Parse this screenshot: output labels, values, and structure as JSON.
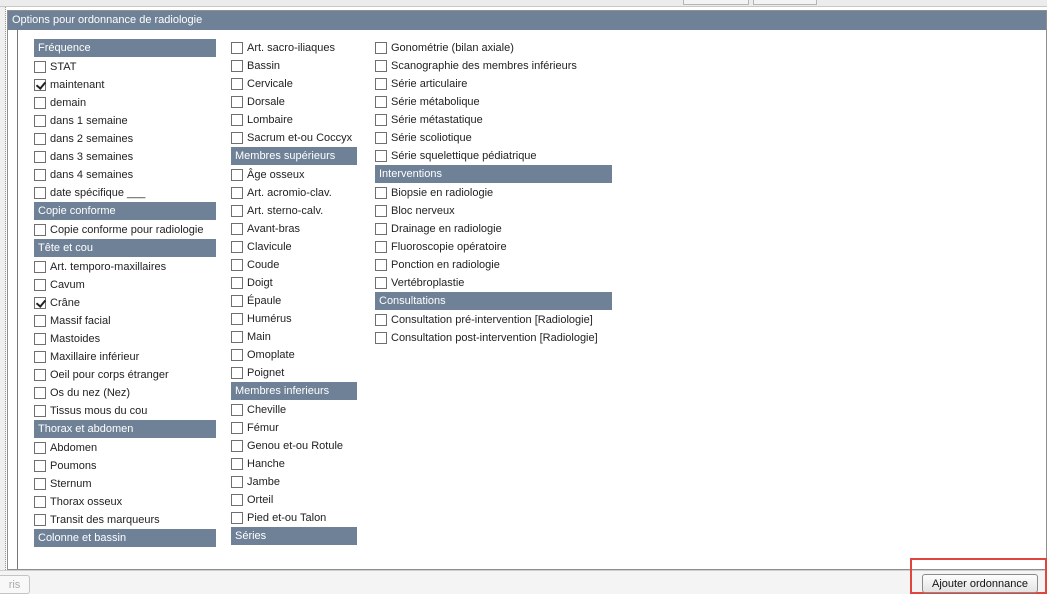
{
  "panel": {
    "title": "Options pour ordonnance de radiologie"
  },
  "columns": [
    [
      {
        "type": "section",
        "label": "Fréquence"
      },
      {
        "type": "option",
        "label": "STAT",
        "checked": false
      },
      {
        "type": "option",
        "label": "maintenant",
        "checked": true
      },
      {
        "type": "option",
        "label": "demain",
        "checked": false
      },
      {
        "type": "option",
        "label": "dans 1 semaine",
        "checked": false
      },
      {
        "type": "option",
        "label": "dans 2 semaines",
        "checked": false
      },
      {
        "type": "option",
        "label": "dans 3 semaines",
        "checked": false
      },
      {
        "type": "option",
        "label": "dans 4 semaines",
        "checked": false
      },
      {
        "type": "option",
        "label": "date spécifique ___",
        "checked": false
      },
      {
        "type": "section",
        "label": "Copie conforme"
      },
      {
        "type": "option",
        "label": "Copie conforme pour radiologie",
        "checked": false
      },
      {
        "type": "section",
        "label": "Tête et cou"
      },
      {
        "type": "option",
        "label": "Art. temporo-maxillaires",
        "checked": false
      },
      {
        "type": "option",
        "label": "Cavum",
        "checked": false
      },
      {
        "type": "option",
        "label": "Crâne",
        "checked": true
      },
      {
        "type": "option",
        "label": "Massif facial",
        "checked": false
      },
      {
        "type": "option",
        "label": "Mastoides",
        "checked": false
      },
      {
        "type": "option",
        "label": "Maxillaire inférieur",
        "checked": false
      },
      {
        "type": "option",
        "label": "Oeil pour corps étranger",
        "checked": false
      },
      {
        "type": "option",
        "label": "Os du nez (Nez)",
        "checked": false
      },
      {
        "type": "option",
        "label": "Tissus mous du cou",
        "checked": false
      },
      {
        "type": "section",
        "label": "Thorax et abdomen"
      },
      {
        "type": "option",
        "label": "Abdomen",
        "checked": false
      },
      {
        "type": "option",
        "label": "Poumons",
        "checked": false
      },
      {
        "type": "option",
        "label": "Sternum",
        "checked": false
      },
      {
        "type": "option",
        "label": "Thorax osseux",
        "checked": false
      },
      {
        "type": "option",
        "label": "Transit des marqueurs",
        "checked": false
      },
      {
        "type": "section",
        "label": "Colonne et bassin"
      }
    ],
    [
      {
        "type": "option",
        "label": "Art. sacro-iliaques",
        "checked": false
      },
      {
        "type": "option",
        "label": "Bassin",
        "checked": false
      },
      {
        "type": "option",
        "label": "Cervicale",
        "checked": false
      },
      {
        "type": "option",
        "label": "Dorsale",
        "checked": false
      },
      {
        "type": "option",
        "label": "Lombaire",
        "checked": false
      },
      {
        "type": "option",
        "label": "Sacrum et-ou Coccyx",
        "checked": false
      },
      {
        "type": "section",
        "label": "Membres supérieurs"
      },
      {
        "type": "option",
        "label": "Âge osseux",
        "checked": false
      },
      {
        "type": "option",
        "label": "Art. acromio-clav.",
        "checked": false
      },
      {
        "type": "option",
        "label": "Art. sterno-calv.",
        "checked": false
      },
      {
        "type": "option",
        "label": "Avant-bras",
        "checked": false
      },
      {
        "type": "option",
        "label": "Clavicule",
        "checked": false
      },
      {
        "type": "option",
        "label": "Coude",
        "checked": false
      },
      {
        "type": "option",
        "label": "Doigt",
        "checked": false
      },
      {
        "type": "option",
        "label": "Épaule",
        "checked": false
      },
      {
        "type": "option",
        "label": "Humérus",
        "checked": false
      },
      {
        "type": "option",
        "label": "Main",
        "checked": false
      },
      {
        "type": "option",
        "label": "Omoplate",
        "checked": false
      },
      {
        "type": "option",
        "label": "Poignet",
        "checked": false
      },
      {
        "type": "section",
        "label": "Membres inferieurs"
      },
      {
        "type": "option",
        "label": "Cheville",
        "checked": false
      },
      {
        "type": "option",
        "label": "Fémur",
        "checked": false
      },
      {
        "type": "option",
        "label": "Genou et-ou Rotule",
        "checked": false
      },
      {
        "type": "option",
        "label": "Hanche",
        "checked": false
      },
      {
        "type": "option",
        "label": "Jambe",
        "checked": false
      },
      {
        "type": "option",
        "label": "Orteil",
        "checked": false
      },
      {
        "type": "option",
        "label": "Pied et-ou Talon",
        "checked": false
      },
      {
        "type": "section",
        "label": "Séries"
      }
    ],
    [
      {
        "type": "option",
        "label": "Gonométrie (bilan axiale)",
        "checked": false
      },
      {
        "type": "option",
        "label": "Scanographie des membres inférieurs",
        "checked": false
      },
      {
        "type": "option",
        "label": "Série articulaire",
        "checked": false
      },
      {
        "type": "option",
        "label": "Série métabolique",
        "checked": false
      },
      {
        "type": "option",
        "label": "Série métastatique",
        "checked": false
      },
      {
        "type": "option",
        "label": "Série scoliotique",
        "checked": false
      },
      {
        "type": "option",
        "label": "Série squelettique pédiatrique",
        "checked": false
      },
      {
        "type": "section",
        "label": "Interventions"
      },
      {
        "type": "option",
        "label": "Biopsie en radiologie",
        "checked": false
      },
      {
        "type": "option",
        "label": "Bloc nerveux",
        "checked": false
      },
      {
        "type": "option",
        "label": "Drainage en radiologie",
        "checked": false
      },
      {
        "type": "option",
        "label": "Fluoroscopie opératoire",
        "checked": false
      },
      {
        "type": "option",
        "label": "Ponction en radiologie",
        "checked": false
      },
      {
        "type": "option",
        "label": "Vertébroplastie",
        "checked": false
      },
      {
        "type": "section",
        "label": "Consultations"
      },
      {
        "type": "option",
        "label": "Consultation pré-intervention [Radiologie]",
        "checked": false
      },
      {
        "type": "option",
        "label": "Consultation post-intervention [Radiologie]",
        "checked": false
      }
    ]
  ],
  "footer": {
    "tab_stub_label": "ris",
    "add_button_label": "Ajouter ordonnance"
  },
  "colors": {
    "section_header": "#6e8197",
    "highlight": "#e0463e"
  }
}
